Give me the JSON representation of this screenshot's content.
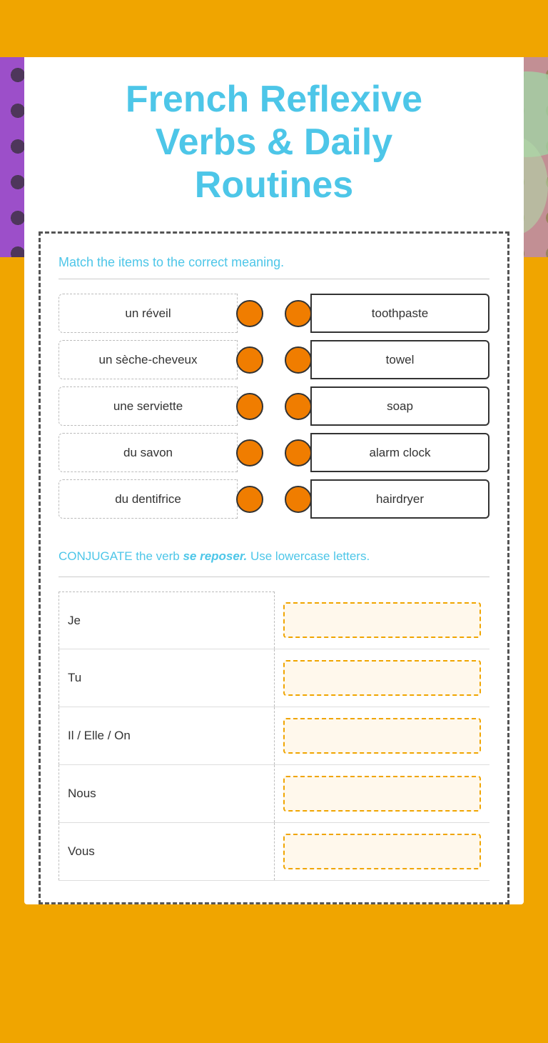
{
  "title": {
    "line1": "French Reflexive",
    "line2": "Verbs & Daily",
    "line3": "Routines"
  },
  "match_section": {
    "instruction": "Match the items to the correct meaning.",
    "pairs": [
      {
        "left": "un réveil",
        "right": "toothpaste"
      },
      {
        "left": "un sèche-cheveux",
        "right": "towel"
      },
      {
        "left": "une serviette",
        "right": "soap"
      },
      {
        "left": "du savon",
        "right": "alarm clock"
      },
      {
        "left": "du dentifrice",
        "right": "hairdryer"
      }
    ]
  },
  "conjugate_section": {
    "instruction_prefix": "CONJUGATE the verb ",
    "verb": "se reposer.",
    "instruction_suffix": "  Use lowercase letters.",
    "subjects": [
      "Je",
      "Tu",
      "Il / Elle / On",
      "Nous",
      "Vous"
    ]
  }
}
